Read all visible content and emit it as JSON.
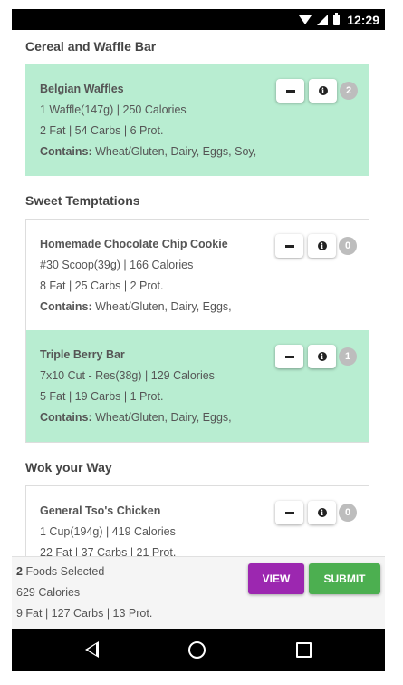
{
  "status": {
    "time": "12:29"
  },
  "sections": [
    {
      "title": "Cereal and Waffle Bar",
      "items": [
        {
          "name": "Belgian Waffles",
          "serving": "1 Waffle(147g) | 250 Calories",
          "macros": "2 Fat | 54 Carbs | 6 Prot.",
          "contains_label": "Contains:",
          "allergens": "Wheat/Gluten, Dairy, Eggs, Soy,",
          "count": "2",
          "selected": true
        }
      ]
    },
    {
      "title": "Sweet Temptations",
      "items": [
        {
          "name": "Homemade Chocolate Chip Cookie",
          "serving": "#30 Scoop(39g) | 166 Calories",
          "macros": "8 Fat | 25 Carbs | 2 Prot.",
          "contains_label": "Contains:",
          "allergens": "Wheat/Gluten, Dairy, Eggs,",
          "count": "0",
          "selected": false
        },
        {
          "name": "Triple Berry Bar",
          "serving": "7x10 Cut - Res(38g) | 129 Calories",
          "macros": "5 Fat | 19 Carbs | 1 Prot.",
          "contains_label": "Contains:",
          "allergens": "Wheat/Gluten, Dairy, Eggs,",
          "count": "1",
          "selected": true
        }
      ]
    },
    {
      "title": "Wok your Way",
      "items": [
        {
          "name": "General Tso's Chicken",
          "serving": "1 Cup(194g) | 419 Calories",
          "macros": "22 Fat | 37 Carbs | 21 Prot.",
          "count": "0",
          "selected": false
        }
      ]
    }
  ],
  "footer": {
    "foods_count": "2",
    "foods_label": "Foods Selected",
    "calories": "629 Calories",
    "macros": "9 Fat | 127 Carbs | 13 Prot.",
    "view_label": "VIEW",
    "submit_label": "SUBMIT"
  },
  "colors": {
    "selected_bg": "#b8edd1",
    "view": "#9c27b0",
    "submit": "#4caf50",
    "badge": "#bdbdbd"
  },
  "icons": {
    "minus": "minus-icon",
    "info": "info-icon",
    "back": "back-icon",
    "home": "home-icon",
    "recents": "recents-icon"
  }
}
